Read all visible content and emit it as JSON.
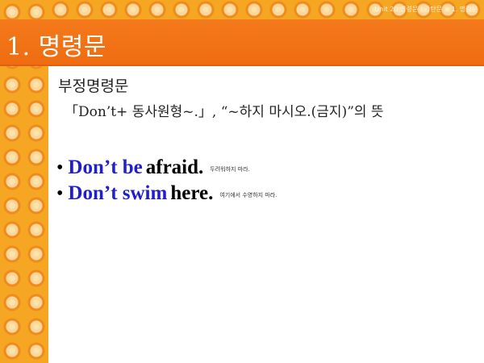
{
  "header": {
    "breadcrumb": "Unit 20 명령문 / 감탄문 > 1. 명령문",
    "title": "1.  명령문"
  },
  "content": {
    "section_label": "부정명령문",
    "rule_line": "「Don’t+ 동사원형~.」, “~하지 마시오.(금지)”의 뜻",
    "examples": [
      {
        "bullet": "•",
        "blue": "Don’t be",
        "black": "afraid.",
        "translation": "두려워하지 마라."
      },
      {
        "bullet": "•",
        "blue": "Don’t swim",
        "black": "here.",
        "translation": "여기에서 수영하지 마라."
      }
    ]
  },
  "colors": {
    "header_orange": "#ef6c10",
    "pattern_orange": "#f5a623",
    "example_blue": "#1f1fd1"
  }
}
